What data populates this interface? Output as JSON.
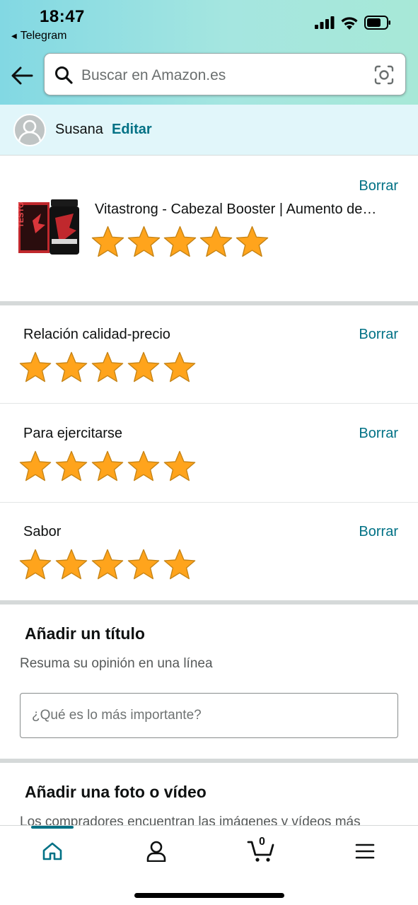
{
  "status": {
    "time": "18:47",
    "back_app": "Telegram"
  },
  "search": {
    "placeholder": "Buscar en Amazon.es"
  },
  "user": {
    "name": "Susana",
    "edit_label": "Editar"
  },
  "product": {
    "title": "Vitastrong - Cabezal Booster | Aumento de testosterona",
    "image_label": "TESTO BOOSTER",
    "rating": 5,
    "clear_label": "Borrar"
  },
  "ratings": [
    {
      "label": "Relación calidad-precio",
      "rating": 5,
      "clear_label": "Borrar"
    },
    {
      "label": "Para ejercitarse",
      "rating": 5,
      "clear_label": "Borrar"
    },
    {
      "label": "Sabor",
      "rating": 5,
      "clear_label": "Borrar"
    }
  ],
  "title_section": {
    "heading": "Añadir un título",
    "subtitle": "Resuma su opinión en una línea",
    "input_placeholder": "¿Qué es lo más importante?"
  },
  "photo_section": {
    "heading": "Añadir una foto o vídeo",
    "description": "Los compradores encuentran las imágenes y vídeos más"
  },
  "nav": {
    "items": [
      "home-icon",
      "account-icon",
      "cart-icon",
      "menu-icon"
    ],
    "cart_count": "0",
    "active": "home"
  },
  "colors": {
    "link": "#007185",
    "star": "#ffa41c",
    "header_gradient_start": "#82d8e3",
    "header_gradient_end": "#a7e8d7",
    "user_bar": "#e1f6fa"
  }
}
